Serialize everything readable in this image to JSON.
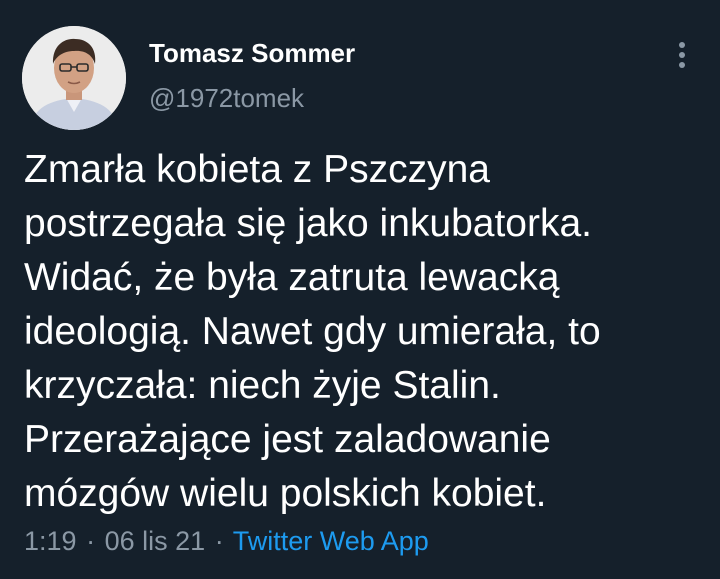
{
  "author": {
    "name": "Tomasz Sommer",
    "handle": "@1972tomek"
  },
  "tweet": {
    "lines": [
      "Zmarła kobieta z Pszczyna",
      "postrzegała się jako inkubatorka.",
      "Widać, że była zatruta lewacką",
      "ideologią. Nawet gdy umierała, to",
      "krzyczała: niech żyje Stalin.",
      "Przerażające jest zaladowanie",
      "mózgów wielu polskich kobiet."
    ]
  },
  "meta": {
    "time": "1:19",
    "separator": "·",
    "date": "06 lis 21",
    "source": "Twitter Web App"
  },
  "icons": {
    "more": "more-vertical-icon"
  },
  "colors": {
    "background": "#15202b",
    "text": "#ffffff",
    "secondary": "#8b98a5",
    "link": "#1d9bf0"
  }
}
